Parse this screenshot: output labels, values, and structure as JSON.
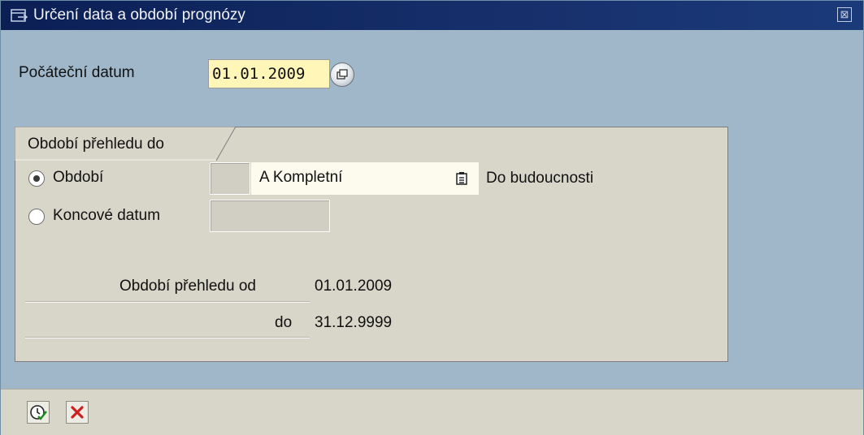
{
  "window": {
    "title": "Určení data a období prognózy",
    "close_glyph": "⊠"
  },
  "start": {
    "label": "Počáteční datum",
    "value": "01.01.2009"
  },
  "group": {
    "title": "Období přehledu do",
    "options": [
      {
        "label": "Období",
        "checked": true
      },
      {
        "label": "Koncové datum",
        "checked": false
      }
    ],
    "period_value": "A Kompletní",
    "period_desc": "Do budoucnosti",
    "from_label": "Období přehledu od",
    "from_value": "01.01.2009",
    "to_label": "do",
    "to_value": "31.12.9999"
  },
  "icons": {
    "title": "open-window-icon",
    "f4": "value-help-icon",
    "list": "list-icon",
    "execute": "execute-clock-icon",
    "cancel": "cancel-x-icon"
  },
  "colors": {
    "background": "#9fb7c9",
    "titlebar": "#0b1f55",
    "input_required": "#fff6b8",
    "group_bg": "#d8d5c9",
    "cancel_red": "#cc1f1f"
  }
}
